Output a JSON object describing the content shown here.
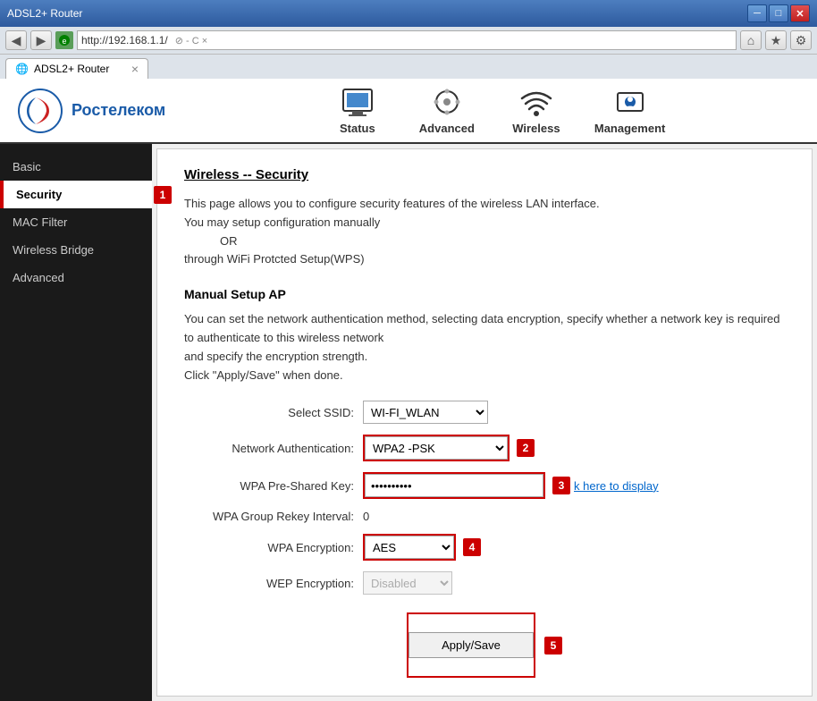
{
  "browser": {
    "title": "ADSL2+ Router",
    "address": "http://192.168.1.1/",
    "favicon": "🌐",
    "tab_label": "ADSL2+ Router",
    "nav_back": "◀",
    "nav_forward": "▶",
    "address_display": "http://192.168.1.1/  ⊘ - C ×"
  },
  "header": {
    "logo_text": "Ростелеком",
    "nav_items": [
      {
        "id": "status",
        "label": "Status"
      },
      {
        "id": "advanced",
        "label": "Advanced"
      },
      {
        "id": "wireless",
        "label": "Wireless"
      },
      {
        "id": "management",
        "label": "Management"
      }
    ]
  },
  "sidebar": {
    "items": [
      {
        "id": "basic",
        "label": "Basic",
        "active": false
      },
      {
        "id": "security",
        "label": "Security",
        "active": true,
        "badge": "1"
      },
      {
        "id": "mac-filter",
        "label": "MAC Filter",
        "active": false
      },
      {
        "id": "wireless-bridge",
        "label": "Wireless Bridge",
        "active": false
      },
      {
        "id": "advanced",
        "label": "Advanced",
        "active": false
      }
    ]
  },
  "content": {
    "title": "Wireless -- Security",
    "description_lines": [
      "This page allows you to configure security features of the wireless LAN interface.",
      "You may setup configuration manually",
      "OR",
      "through WiFi Protcted Setup(WPS)"
    ],
    "section_title": "Manual Setup AP",
    "section_description": "You can set the network authentication method, selecting data encryption, specify whether a network key is required to authenticate to this wireless network\nand specify the encryption strength.\nClick \"Apply/Save\" when done.",
    "form": {
      "select_ssid_label": "Select SSID:",
      "select_ssid_value": "WI-FI_WLAN",
      "network_auth_label": "Network Authentication:",
      "network_auth_value": "WPA2 -PSK",
      "network_auth_badge": "2",
      "wpa_key_label": "WPA Pre-Shared Key:",
      "wpa_key_value": "••••••••••",
      "wpa_key_badge": "3",
      "wpa_key_link": "k here to display",
      "wpa_rekey_label": "WPA Group Rekey Interval:",
      "wpa_rekey_value": "0",
      "wpa_encryption_label": "WPA Encryption:",
      "wpa_encryption_value": "AES",
      "wpa_encryption_badge": "4",
      "wep_encryption_label": "WEP Encryption:",
      "wep_encryption_value": "Disabled",
      "apply_save_label": "Apply/Save",
      "apply_save_badge": "5"
    }
  }
}
